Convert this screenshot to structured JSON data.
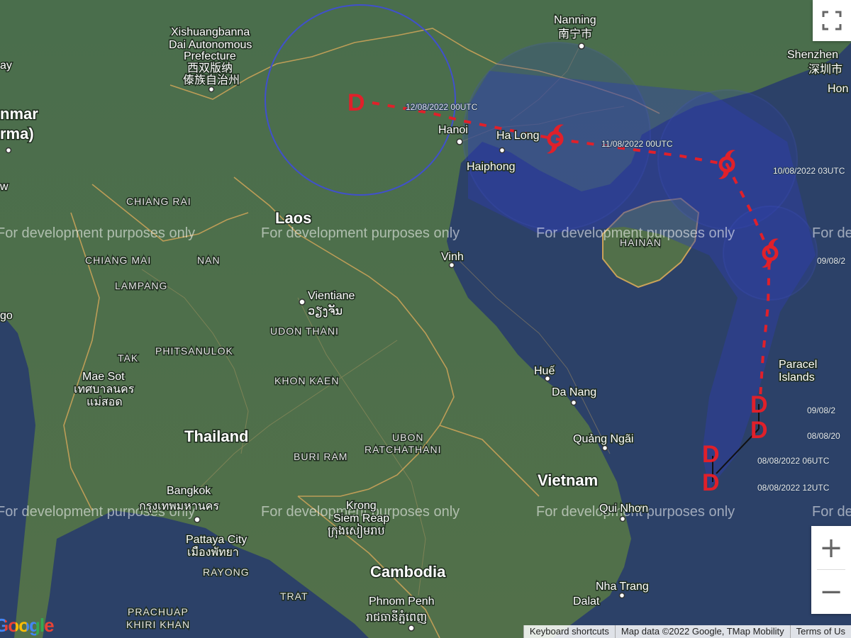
{
  "countries": [
    "Laos",
    "Thailand",
    "Vietnam",
    "Cambodia",
    "nmar",
    "rma)"
  ],
  "cities": [
    {
      "name": "Nanning"
    },
    {
      "name": "南宁市"
    },
    {
      "name": "Shenzhen"
    },
    {
      "name": "深圳市"
    },
    {
      "name": "Hon"
    },
    {
      "name": "Hanoi"
    },
    {
      "name": "Ha Long"
    },
    {
      "name": "Haiphong"
    },
    {
      "name": "Vinh"
    },
    {
      "name": "Vientiane"
    },
    {
      "name": "ວຽງຈັນ"
    },
    {
      "name": "Huế"
    },
    {
      "name": "Da Nang"
    },
    {
      "name": "Quảng Ngãi"
    },
    {
      "name": "Qui Nhơn"
    },
    {
      "name": "Nha Trang"
    },
    {
      "name": "Dalat"
    },
    {
      "name": "Bangkok"
    },
    {
      "name": "กรุงเทพมหานคร"
    },
    {
      "name": "Pattaya City"
    },
    {
      "name": "เมืองพัทยา"
    },
    {
      "name": "Phnom Penh"
    },
    {
      "name": "រាជធានីភ្នំពេញ"
    },
    {
      "name": "Krong"
    },
    {
      "name": "Siem Reap"
    },
    {
      "name": "ក្រុងសៀមរាប"
    },
    {
      "name": "Mae Sot"
    },
    {
      "name": "เทศบาลนคร"
    },
    {
      "name": "แม่สอด"
    },
    {
      "name": "Paracel"
    },
    {
      "name": "Islands"
    },
    {
      "name": "Xishuangbanna"
    },
    {
      "name": "Dai Autonomous"
    },
    {
      "name": "Prefecture"
    },
    {
      "name": "西双版纳"
    },
    {
      "name": "傣族自治州"
    },
    {
      "name": "ay"
    },
    {
      "name": "go"
    },
    {
      "name": "w"
    }
  ],
  "provinces": [
    "CHIANG RAI",
    "CHIANG MAI",
    "NAN",
    "LAMPANG",
    "UDON THANI",
    "PHITSANULOK",
    "TAK",
    "KHON KAEN",
    "UBON",
    "RATCHATHANI",
    "BURI RAM",
    "RAYONG",
    "TRAT",
    "PRACHUAP",
    "KHIRI KHAN",
    "HAINAN"
  ],
  "watermark": "For development purposes only",
  "storm_track": {
    "timestamps": [
      "12/08/2022 00UTC",
      "11/08/2022 00UTC",
      "10/08/2022 03UTC",
      "09/08/2",
      "09/08/2",
      "08/08/20",
      "08/08/2022 06UTC",
      "08/08/2022 12UTC"
    ],
    "markers": [
      "D",
      "D",
      "D",
      "D",
      "D"
    ],
    "cone_color": "#2f3fb0",
    "track_color": "#e0202a",
    "icons": [
      "cyclone-icon",
      "cyclone-icon",
      "cyclone-icon"
    ]
  },
  "controls": {
    "zoom_in": "+",
    "zoom_out": "−"
  },
  "footer": {
    "keyboard": "Keyboard shortcuts",
    "mapdata": "Map data ©2022 Google, TMap Mobility",
    "terms": "Terms of Us"
  },
  "logo": "Google",
  "colors": {
    "land": "#4d6a48",
    "sea": "#2c4168",
    "border": "#c9a259"
  }
}
